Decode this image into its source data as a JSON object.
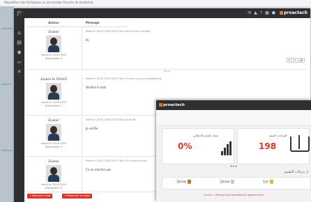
{
  "background_window": {
    "title": "Répartition des formations ou les enroller Ouverts de Academia"
  },
  "forum_window": {
    "brand": "proactech",
    "columns": {
      "author": "Auteur",
      "message": "Message"
    },
    "sidebar_icons": [
      "home-icon",
      "calendar-icon",
      "chat-icon",
      "monitor-icon",
      "tools-icon"
    ],
    "posts": [
      {
        "author": "Zoubair",
        "meta_line1": "Inscrit le: 29-03-2019",
        "meta_line2": "Discussions: 4",
        "posted": "Posté le: 28-01-2019 16:23   Titre: Hello Forum test bati",
        "body": "Hi,"
      },
      {
        "author": "Zoubair EL ROUAFI",
        "meta_line1": "Inscrit le: 29-03-2019",
        "meta_line2": "Discussions: 1",
        "posted": "Posté le: 28-01-2019 16:23   Titre: On bien reçu sur la plateforme",
        "body": "Vérifiez le mail"
      },
      {
        "author": "Zoubair",
        "meta_line1": "Inscrit le: 29-03-2019",
        "meta_line2": "Discussions: 4",
        "posted": "Posté le: 28-01-2019 16:23   Titre: Je vérifie",
        "body": "Je vérifie"
      },
      {
        "author": "Zoubair",
        "meta_line1": "Inscrit le: 29-03-2019",
        "meta_line2": "Discussions: 4",
        "posted": "Posté le: 28-01-2019 16:23   Titre: Ca ne marche pas",
        "body": "Ca ne marche pas"
      }
    ],
    "dots": "•••",
    "buttons": {
      "new_topic": "Nouveau Sujet",
      "reply": "Répondre au sujet"
    },
    "accent": "#d9352b"
  },
  "dashboard_window": {
    "brand": "proactech",
    "card_progress": {
      "title": "معدل التقدم الإجمالي",
      "value": "0%"
    },
    "card_points": {
      "title": "الوحدات العينية",
      "value": "198"
    },
    "dots": "•••",
    "section_title": "ل درجات التقييم",
    "ranks": [
      {
        "label": "3ème",
        "color": "#c8742a"
      },
      {
        "label": "2ème",
        "color": "#c9c9c9"
      },
      {
        "label": "1er",
        "color": "#e8b822"
      }
    ],
    "footer_prefix": "Session : ",
    "footer_link": "Parcours de formation en gestion de p"
  }
}
